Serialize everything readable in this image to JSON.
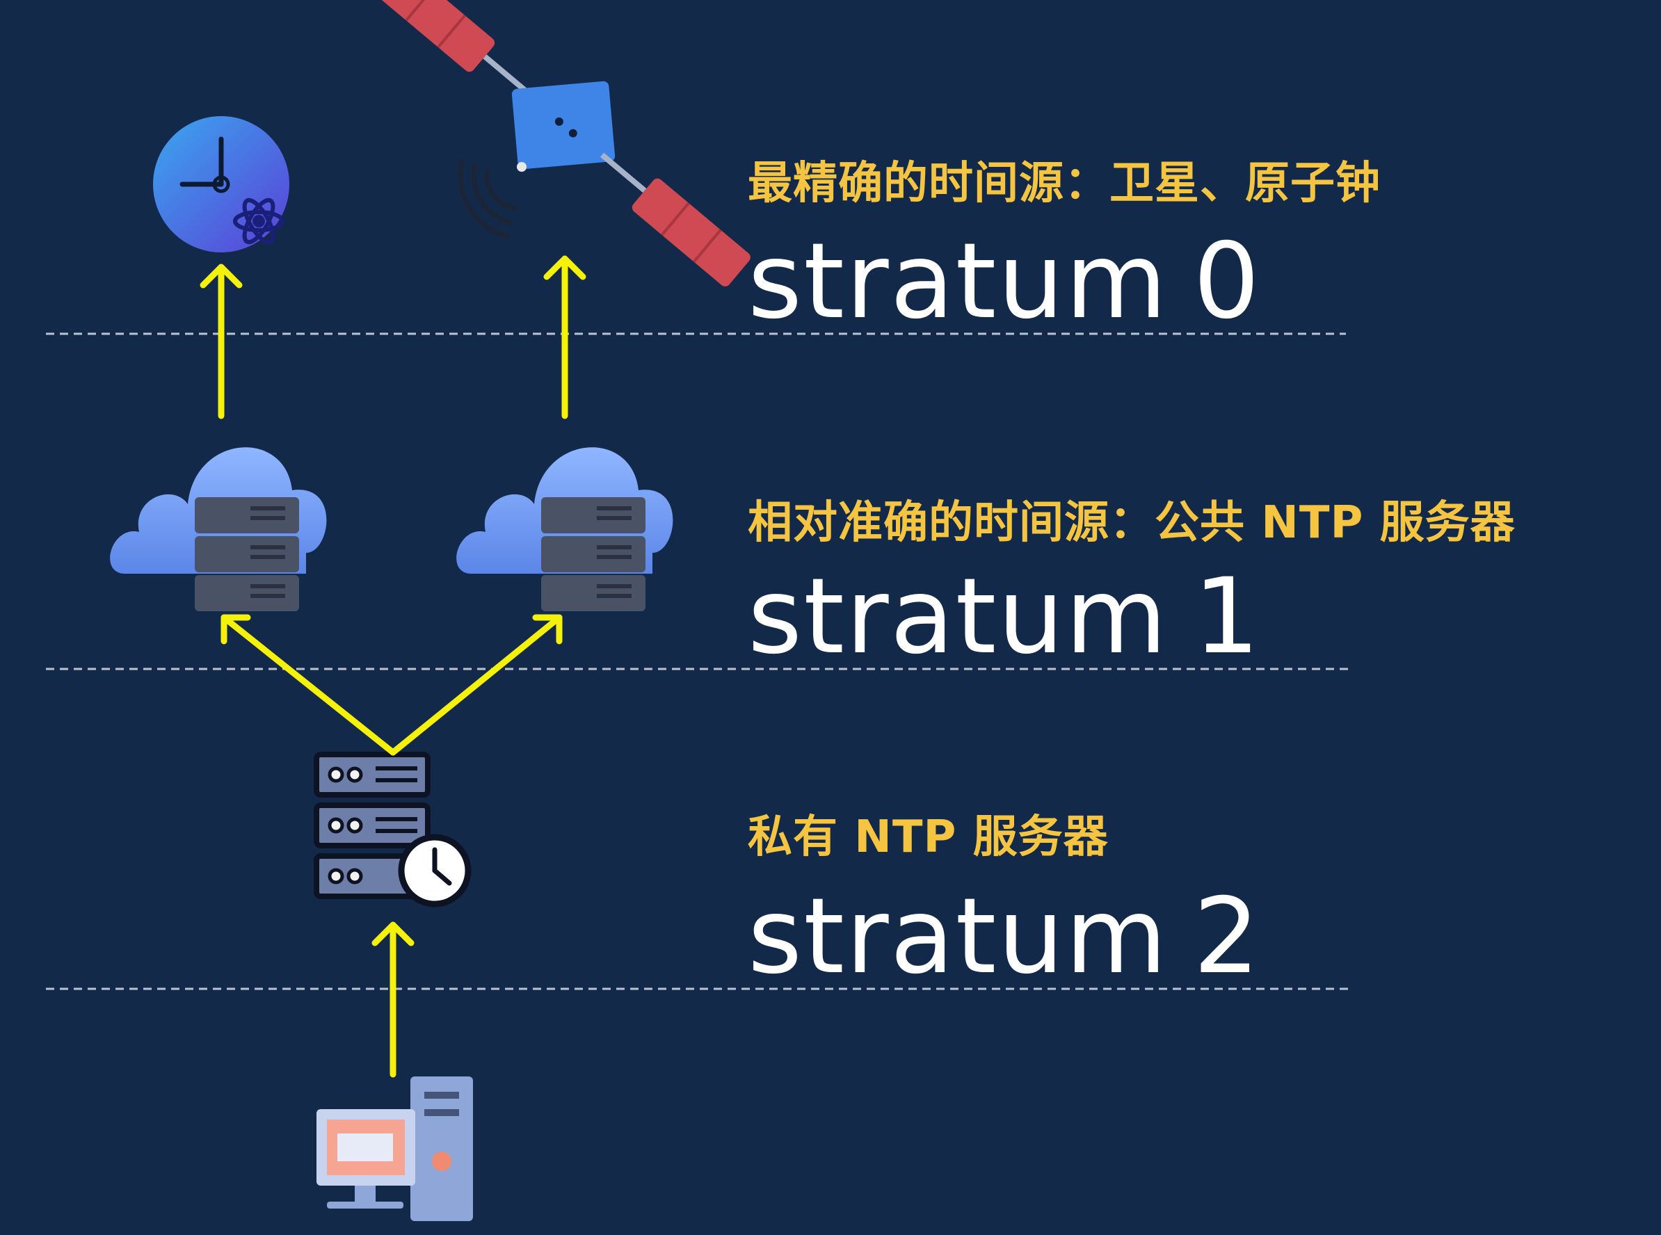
{
  "levels": [
    {
      "description": "最精确的时间源：卫星、原子钟",
      "stratum_word": "stratum",
      "stratum_number": "0"
    },
    {
      "description": "相对准确的时间源：公共 NTP 服务器",
      "stratum_word": "stratum",
      "stratum_number": "1"
    },
    {
      "description": "私有 NTP 服务器",
      "stratum_word": "stratum",
      "stratum_number": "2"
    }
  ],
  "icons": {
    "atomic_clock": "atomic-clock-icon",
    "satellite": "satellite-icon",
    "public_ntp_server_left": "cloud-server-icon",
    "public_ntp_server_right": "cloud-server-icon",
    "private_ntp_server": "server-clock-icon",
    "client": "desktop-computer-icon"
  },
  "colors": {
    "background": "#13294a",
    "arrow": "#f5f10a",
    "description_text": "#f5c542",
    "stratum_text": "#ffffff",
    "divider": "#d9dee8"
  }
}
